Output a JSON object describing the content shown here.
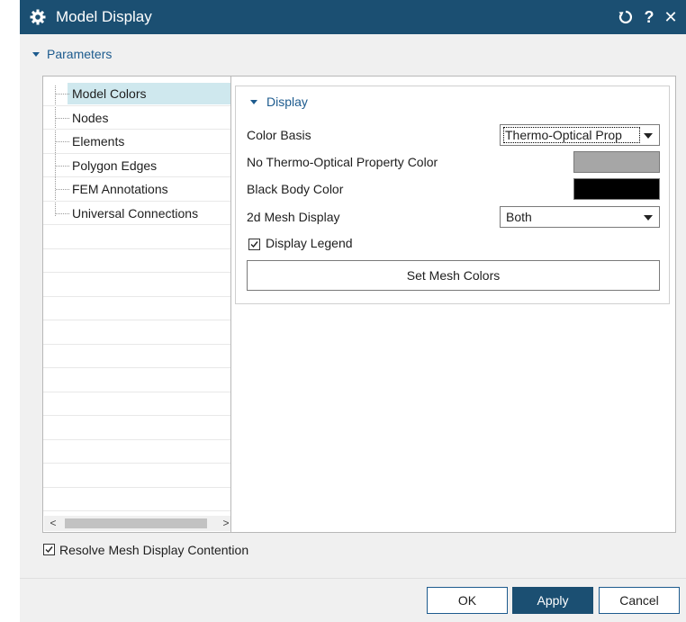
{
  "window": {
    "title": "Model Display",
    "icons": {
      "app": "gear-icon",
      "reset": "reset-icon",
      "help": "help-icon",
      "close": "close-icon"
    },
    "help_glyph": "?",
    "close_glyph": "✕"
  },
  "parameters": {
    "label": "Parameters"
  },
  "tree": {
    "items": [
      {
        "label": "Model Colors",
        "selected": true
      },
      {
        "label": "Nodes"
      },
      {
        "label": "Elements"
      },
      {
        "label": "Polygon Edges"
      },
      {
        "label": "FEM Annotations"
      },
      {
        "label": "Universal Connections"
      }
    ],
    "scroll_left": "<",
    "scroll_right": ">"
  },
  "display": {
    "title": "Display",
    "color_basis": {
      "label": "Color Basis",
      "value": "Thermo-Optical Prop"
    },
    "no_thermo_color": {
      "label": "No Thermo-Optical Property Color",
      "color": "#a6a6a6"
    },
    "black_body_color": {
      "label": "Black Body Color",
      "color": "#000000"
    },
    "mesh_display": {
      "label": "2d Mesh Display",
      "value": "Both"
    },
    "display_legend": {
      "label": "Display Legend",
      "checked": true
    },
    "set_mesh_colors": "Set Mesh Colors"
  },
  "resolve": {
    "label": "Resolve Mesh Display Contention",
    "checked": true
  },
  "buttons": {
    "ok": "OK",
    "apply": "Apply",
    "cancel": "Cancel"
  },
  "colors": {
    "titlebar": "#1b4f72",
    "accent": "#1d5b8e",
    "selection": "#cfe8ee"
  }
}
